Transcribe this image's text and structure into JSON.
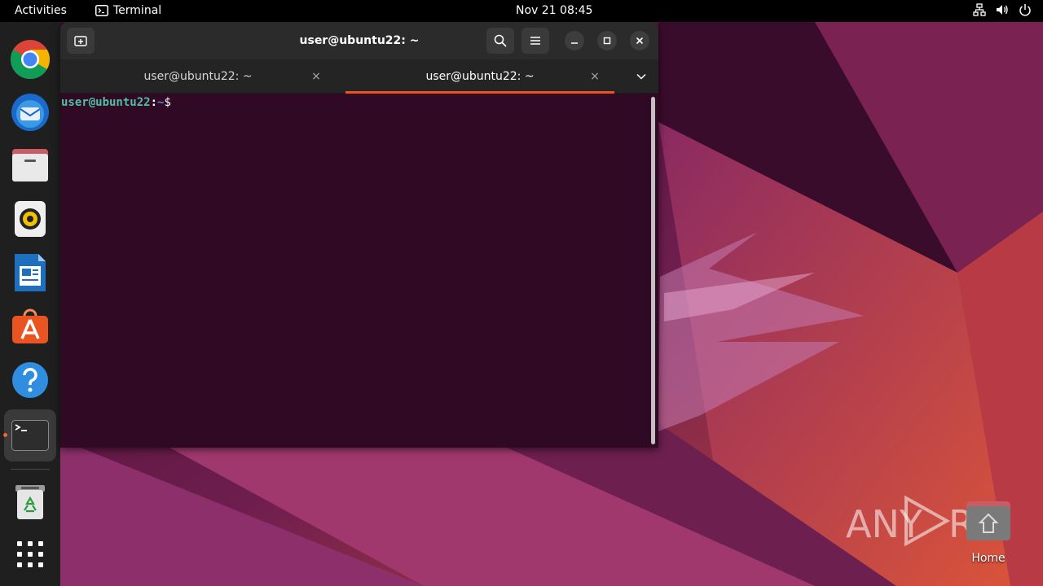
{
  "topbar": {
    "activities": "Activities",
    "app_name": "Terminal",
    "clock": "Nov 21  08:45",
    "tray": [
      "network-icon",
      "volume-icon",
      "power-icon"
    ]
  },
  "dock": {
    "apps": [
      "Google Chrome",
      "Thunderbird Mail",
      "Files",
      "Rhythmbox",
      "LibreOffice Writer",
      "Ubuntu Software",
      "Help",
      "Terminal",
      "Trash",
      "Show Applications"
    ],
    "running_indicator_color": "#e95420"
  },
  "window": {
    "title": "user@ubuntu22: ~",
    "tabs": [
      {
        "label": "user@ubuntu22: ~",
        "active": false
      },
      {
        "label": "user@ubuntu22: ~",
        "active": true
      }
    ],
    "tab_close_glyph": "×",
    "prompt": {
      "user_host": "user@ubuntu22",
      "colon": ":",
      "path": "~",
      "symbol": "$"
    }
  },
  "desktop": {
    "home_label": "Home",
    "watermark": "ANY RUN"
  },
  "colors": {
    "accent": "#e95420",
    "terminal_bg": "#300a24",
    "prompt_user": "#4ec2a0",
    "prompt_path": "#5c8bd6"
  }
}
